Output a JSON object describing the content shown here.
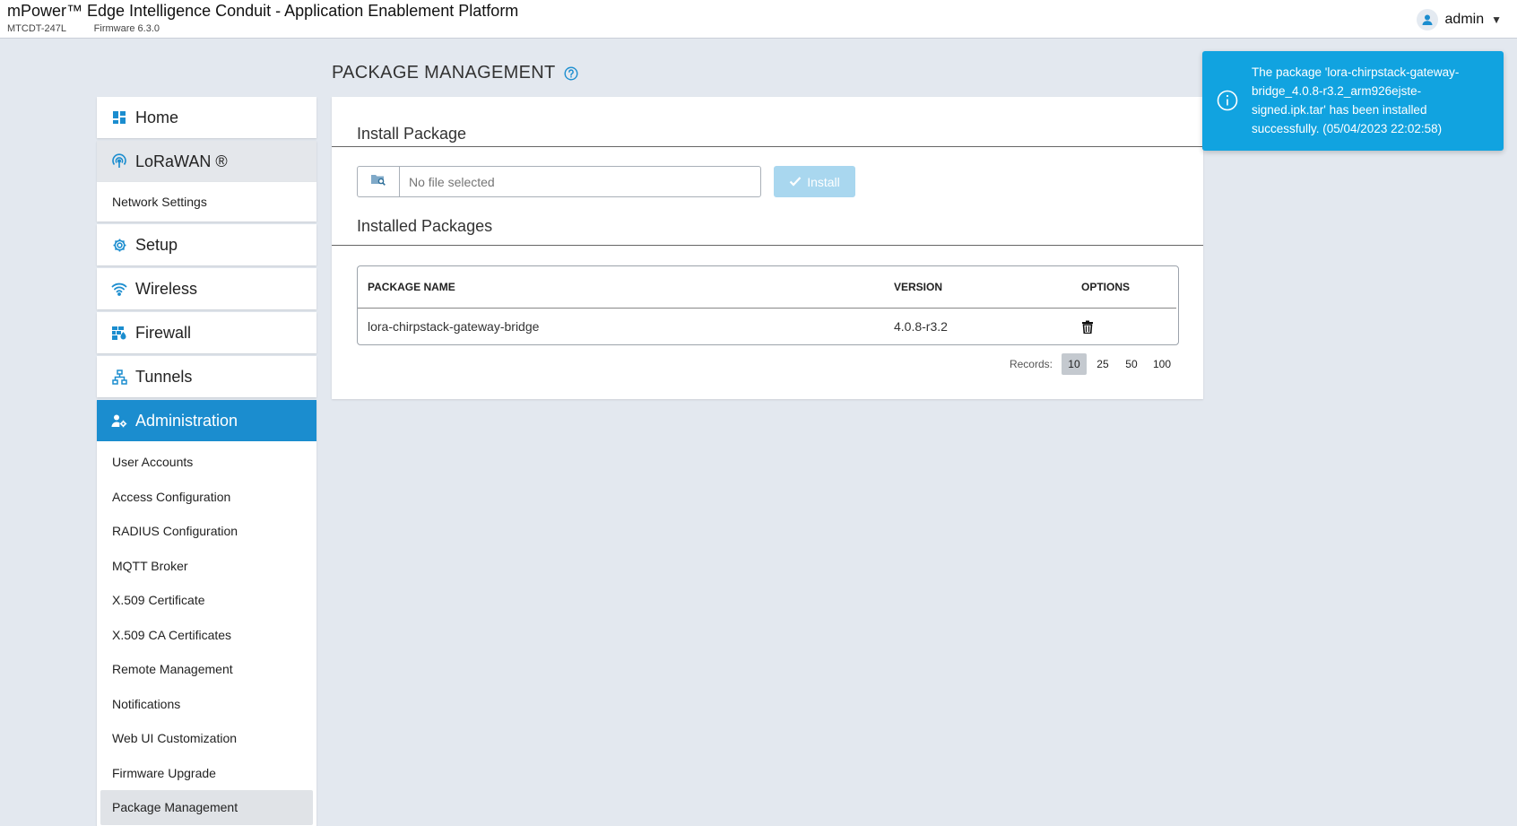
{
  "header": {
    "title": "mPower™ Edge Intelligence Conduit - Application Enablement Platform",
    "model": "MTCDT-247L",
    "firmware": "Firmware 6.3.0",
    "user": "admin",
    "user_caret": "▼"
  },
  "sidebar": {
    "home": "Home",
    "lorawan": "LoRaWAN ®",
    "lorawan_items": [
      "Network Settings"
    ],
    "setup": "Setup",
    "wireless": "Wireless",
    "firewall": "Firewall",
    "tunnels": "Tunnels",
    "administration": "Administration",
    "admin_items": [
      "User Accounts",
      "Access Configuration",
      "RADIUS Configuration",
      "MQTT Broker",
      "X.509 Certificate",
      "X.509 CA Certificates",
      "Remote Management",
      "Notifications",
      "Web UI Customization",
      "Firmware Upgrade",
      "Package Management"
    ]
  },
  "page": {
    "title": "PACKAGE MANAGEMENT",
    "install_section": "Install Package",
    "file_placeholder": "No file selected",
    "install_button": "Install",
    "installed_section": "Installed Packages",
    "table": {
      "columns": [
        "PACKAGE NAME",
        "VERSION",
        "OPTIONS"
      ],
      "rows": [
        {
          "name": "lora-chirpstack-gateway-bridge",
          "version": "4.0.8-r3.2"
        }
      ]
    },
    "records_label": "Records:",
    "records_options": [
      "10",
      "25",
      "50",
      "100"
    ],
    "records_selected": "10"
  },
  "toast": {
    "message": "The package 'lora-chirpstack-gateway-bridge_4.0.8-r3.2_arm926ejste-signed.ipk.tar' has been installed successfully. (05/04/2023 22:02:58)"
  },
  "colors": {
    "accent": "#1b8dcf",
    "toast": "#11a3e0",
    "background": "#e3e8ef"
  },
  "icons": [
    "user-icon",
    "home-icon",
    "lorawan-icon",
    "setup-gear-icon",
    "wireless-icon",
    "firewall-icon",
    "tunnels-icon",
    "administration-icon",
    "help-icon",
    "file-browse-icon",
    "check-icon",
    "trash-icon",
    "info-icon"
  ]
}
